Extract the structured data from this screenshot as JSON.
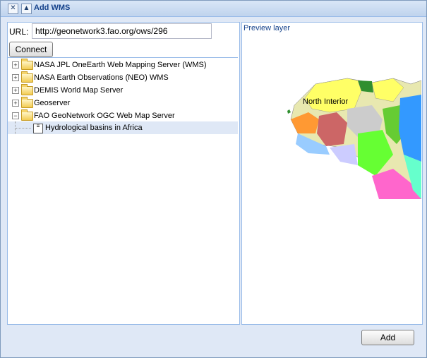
{
  "window": {
    "title": "Add WMS",
    "close_icon": "close-icon",
    "collapse_icon": "collapse-icon"
  },
  "url": {
    "label": "URL:",
    "value": "http://geonetwork3.fao.org/ows/296"
  },
  "connect_label": "Connect",
  "tree": {
    "servers": [
      {
        "label": "NASA JPL OneEarth Web Mapping Server (WMS)",
        "expanded": false
      },
      {
        "label": "NASA Earth Observations (NEO) WMS",
        "expanded": false
      },
      {
        "label": "DEMIS World Map Server",
        "expanded": false
      },
      {
        "label": "Geoserver",
        "expanded": false
      },
      {
        "label": "FAO GeoNetwork OGC Web Map Server",
        "expanded": true
      }
    ],
    "layers": [
      {
        "label": "Hydrological basins in Africa"
      }
    ]
  },
  "preview": {
    "title": "Preview layer",
    "map_label": "North Interior"
  },
  "add_label": "Add",
  "colors": {
    "title": "#15428b",
    "panel_border": "#99bbe8",
    "selected_row": "#dfe8f6"
  }
}
